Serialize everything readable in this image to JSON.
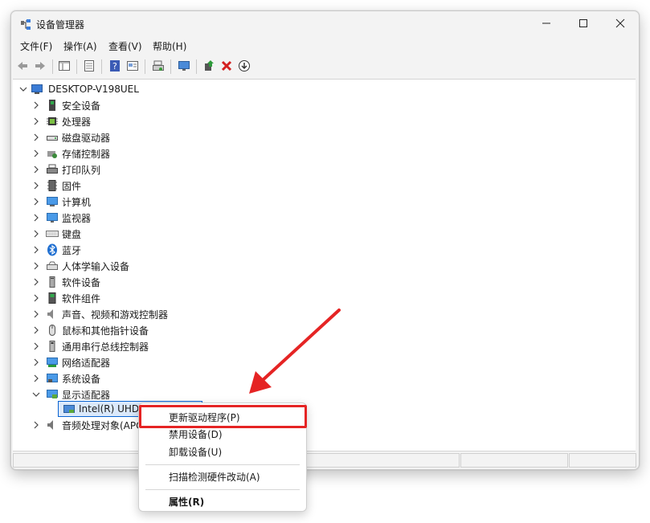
{
  "window": {
    "title": "设备管理器",
    "controls": {
      "minimize": "minimize-icon",
      "maximize": "maximize-icon",
      "close": "close-icon"
    }
  },
  "menubar": [
    {
      "label": "文件(F)"
    },
    {
      "label": "操作(A)"
    },
    {
      "label": "查看(V)"
    },
    {
      "label": "帮助(H)"
    }
  ],
  "toolbar": {
    "icons": [
      "back-arrow-icon",
      "forward-arrow-icon",
      "properties-pane-icon",
      "driver-details-icon",
      "help-icon",
      "show-hidden-icon",
      "printer-settings-icon",
      "monitor-icon",
      "update-driver-icon",
      "uninstall-x-icon",
      "disable-device-icon"
    ]
  },
  "tree": {
    "root": "DESKTOP-V198UEL",
    "categories": [
      {
        "label": "安全设备",
        "icon": "security-device-icon"
      },
      {
        "label": "处理器",
        "icon": "processor-icon"
      },
      {
        "label": "磁盘驱动器",
        "icon": "disk-drive-icon"
      },
      {
        "label": "存储控制器",
        "icon": "storage-controller-icon"
      },
      {
        "label": "打印队列",
        "icon": "printer-icon"
      },
      {
        "label": "固件",
        "icon": "firmware-icon"
      },
      {
        "label": "计算机",
        "icon": "computer-icon"
      },
      {
        "label": "监视器",
        "icon": "monitor-icon"
      },
      {
        "label": "键盘",
        "icon": "keyboard-icon"
      },
      {
        "label": "蓝牙",
        "icon": "bluetooth-icon"
      },
      {
        "label": "人体学输入设备",
        "icon": "hid-icon"
      },
      {
        "label": "软件设备",
        "icon": "software-device-icon"
      },
      {
        "label": "软件组件",
        "icon": "software-component-icon"
      },
      {
        "label": "声音、视频和游戏控制器",
        "icon": "speaker-icon"
      },
      {
        "label": "鼠标和其他指针设备",
        "icon": "mouse-icon"
      },
      {
        "label": "通用串行总线控制器",
        "icon": "usb-icon"
      },
      {
        "label": "网络适配器",
        "icon": "network-adapter-icon"
      },
      {
        "label": "系统设备",
        "icon": "system-device-icon"
      },
      {
        "label": "显示适配器",
        "icon": "display-adapter-icon",
        "expanded": true
      }
    ],
    "selected_child": "Intel(R) UHD",
    "after_item": {
      "label": "音频处理对象(APO",
      "icon": "audio-processing-icon"
    }
  },
  "context_menu": {
    "items": [
      {
        "label": "更新驱动程序(P)"
      },
      {
        "label": "禁用设备(D)"
      },
      {
        "label": "卸载设备(U)"
      },
      {
        "label": "扫描检测硬件改动(A)"
      },
      {
        "label": "属性(R)"
      }
    ]
  },
  "colors": {
    "annotation_red": "#e52424",
    "selection_blue": "#0a64d2",
    "window_bg": "#f3f3f3"
  }
}
